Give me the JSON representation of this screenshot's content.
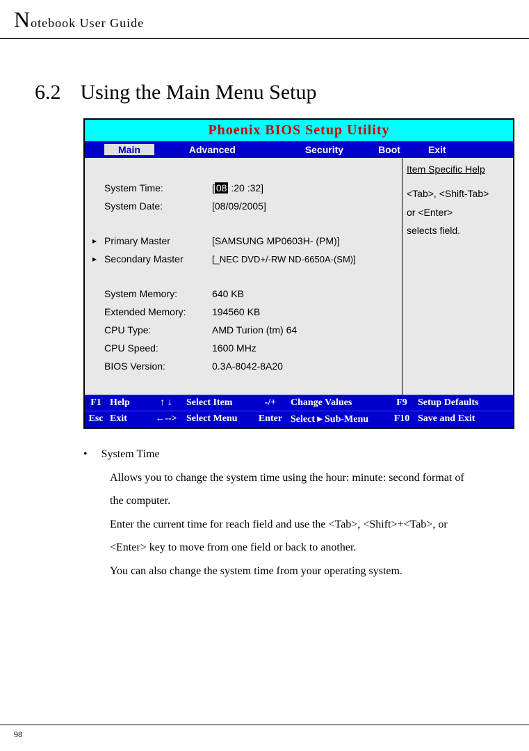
{
  "header": {
    "title": "Notebook User Guide"
  },
  "section": {
    "number": "6.2",
    "title": "Using the Main Menu Setup"
  },
  "bios": {
    "title": "Phoenix BIOS Setup Utility",
    "tabs": {
      "main": "Main",
      "advanced": "Advanced",
      "security": "Security",
      "boot": "Boot",
      "exit": "Exit"
    },
    "help": {
      "header": "Item Specific Help",
      "line1": "<Tab>, <Shift-Tab>",
      "line2": "or <Enter>",
      "line3": "selects field."
    },
    "rows": {
      "system_time_label": "System Time:",
      "system_time_value_prefix": "[",
      "system_time_hour": "08",
      "system_time_value_suffix": " :20 :32]",
      "system_date_label": "System Date:",
      "system_date_value": "[08/09/2005]",
      "primary_master_label": "Primary Master",
      "primary_master_value": "[SAMSUNG MP0603H- (PM)]",
      "secondary_master_label": "Secondary Master",
      "secondary_master_value": "[_NEC DVD+/-RW ND-6650A-(SM)]",
      "system_memory_label": "System Memory:",
      "system_memory_value": "640 KB",
      "extended_memory_label": "Extended Memory:",
      "extended_memory_value": "194560 KB",
      "cpu_type_label": "CPU Type:",
      "cpu_type_value": "AMD Turion (tm) 64",
      "cpu_speed_label": "CPU Speed:",
      "cpu_speed_value": "1600 MHz",
      "bios_version_label": "BIOS Version:",
      "bios_version_value": "0.3A-8042-8A20"
    },
    "footer": {
      "f1_key": "F1",
      "f1_label": "Help",
      "updown_key": "↑ ↓",
      "updown_label": "Select Item",
      "plusminus_key": "-/+",
      "plusminus_label": "Change Values",
      "f9_key": "F9",
      "f9_label": "Setup Defaults",
      "esc_key": "Esc",
      "esc_label": "Exit",
      "leftright_key": "←-->",
      "leftright_label": "Select Menu",
      "enter_key": "Enter",
      "enter_label": "Select ▸ Sub-Menu",
      "f10_key": "F10",
      "f10_label": "Save and Exit"
    }
  },
  "body": {
    "bullet_title": "System Time",
    "desc1": "Allows you to change the system time using the hour: minute: second format of the computer.",
    "desc2": "Enter the current time for reach field and use the <Tab>, <Shift>+<Tab>, or <Enter> key to move from one field or back to another.",
    "desc3": "You can also change the system time from your operating system."
  },
  "page_number": "98"
}
